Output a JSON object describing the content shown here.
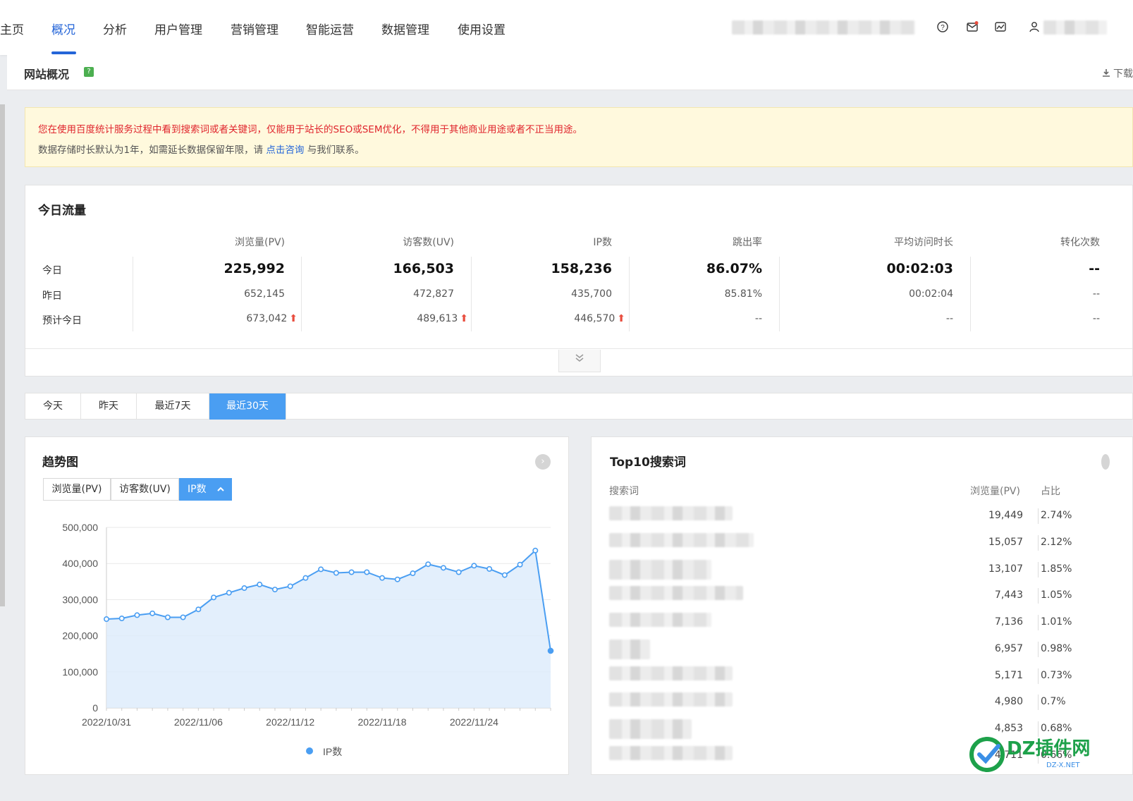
{
  "nav": {
    "items": [
      "主页",
      "概况",
      "分析",
      "用户管理",
      "营销管理",
      "智能运营",
      "数据管理",
      "使用设置"
    ],
    "active": "概况",
    "icons": [
      "help-circle-icon",
      "mail-icon",
      "chart-window-icon",
      "user-icon"
    ]
  },
  "page": {
    "title": "网站概况",
    "help_badge": "?",
    "download_label": "下载"
  },
  "notice": {
    "line1": "您在使用百度统计服务过程中看到搜索词或者关键词，仅能用于站长的SEO或SEM优化，不得用于其他商业用途或者不正当用途。",
    "line2_prefix": "数据存储时长默认为1年，如需延长数据保留年限，请",
    "line2_link": "点击咨询",
    "line2_suffix": "与我们联系。"
  },
  "today": {
    "title": "今日流量",
    "columns": [
      "浏览量(PV)",
      "访客数(UV)",
      "IP数",
      "跳出率",
      "平均访问时长",
      "转化次数"
    ],
    "rows": [
      {
        "label": "今日",
        "values": [
          "225,992",
          "166,503",
          "158,236",
          "86.07%",
          "00:02:03",
          "--"
        ]
      },
      {
        "label": "昨日",
        "values": [
          "652,145",
          "472,827",
          "435,700",
          "85.81%",
          "00:02:04",
          "--"
        ]
      },
      {
        "label": "预计今日",
        "values": [
          "673,042",
          "489,613",
          "446,570",
          "--",
          "--",
          "--"
        ],
        "up": [
          true,
          true,
          true,
          false,
          false,
          false
        ]
      }
    ],
    "up_arrow": "⬆",
    "expand_icon": "double-chevron-down-icon"
  },
  "range_tabs": {
    "items": [
      "今天",
      "昨天",
      "最近7天",
      "最近30天"
    ],
    "selected": "最近30天"
  },
  "trend": {
    "title": "趋势图",
    "metric_tabs": [
      "浏览量(PV)",
      "访客数(UV)",
      "IP数"
    ],
    "selected_metric": "IP数",
    "legend": "IP数"
  },
  "chart_data": {
    "type": "area",
    "title": "",
    "series": [
      {
        "name": "IP数",
        "color": "#4a9ef2",
        "values": [
          246000,
          248000,
          257000,
          262000,
          251000,
          251000,
          273000,
          306000,
          319000,
          332000,
          342000,
          328000,
          337000,
          360000,
          384000,
          374000,
          376000,
          376000,
          360000,
          356000,
          373000,
          398000,
          388000,
          376000,
          394000,
          385000,
          368000,
          397000,
          436000,
          158236
        ]
      }
    ],
    "x": [
      "2022/10/31",
      "2022/11/01",
      "2022/11/02",
      "2022/11/03",
      "2022/11/04",
      "2022/11/05",
      "2022/11/06",
      "2022/11/07",
      "2022/11/08",
      "2022/11/09",
      "2022/11/10",
      "2022/11/11",
      "2022/11/12",
      "2022/11/13",
      "2022/11/14",
      "2022/11/15",
      "2022/11/16",
      "2022/11/17",
      "2022/11/18",
      "2022/11/19",
      "2022/11/20",
      "2022/11/21",
      "2022/11/22",
      "2022/11/23",
      "2022/11/24",
      "2022/11/25",
      "2022/11/26",
      "2022/11/27",
      "2022/11/28",
      "2022/11/29"
    ],
    "x_tick_labels": [
      "2022/10/31",
      "2022/11/06",
      "2022/11/12",
      "2022/11/18",
      "2022/11/24"
    ],
    "y_ticks": [
      "0",
      "100,000",
      "200,000",
      "300,000",
      "400,000",
      "500,000"
    ],
    "ylim": [
      0,
      500000
    ],
    "grid": true,
    "legend_position": "bottom"
  },
  "keywords": {
    "title": "Top10搜索词",
    "headers": [
      "搜索词",
      "浏览量(PV)",
      "占比"
    ],
    "rows": [
      {
        "pv": "19,449",
        "pct": "2.74%"
      },
      {
        "pv": "15,057",
        "pct": "2.12%"
      },
      {
        "pv": "13,107",
        "pct": "1.85%"
      },
      {
        "pv": "7,443",
        "pct": "1.05%"
      },
      {
        "pv": "7,136",
        "pct": "1.01%"
      },
      {
        "pv": "6,957",
        "pct": "0.98%"
      },
      {
        "pv": "5,171",
        "pct": "0.73%"
      },
      {
        "pv": "4,980",
        "pct": "0.7%"
      },
      {
        "pv": "4,853",
        "pct": "0.68%"
      },
      {
        "pv": "4,711",
        "pct": "0.66%"
      }
    ]
  },
  "watermark": {
    "main": "DZ插件网",
    "sub": "DZ-X.NET",
    "colors": [
      "#1da14a",
      "#3b8fe6"
    ]
  }
}
